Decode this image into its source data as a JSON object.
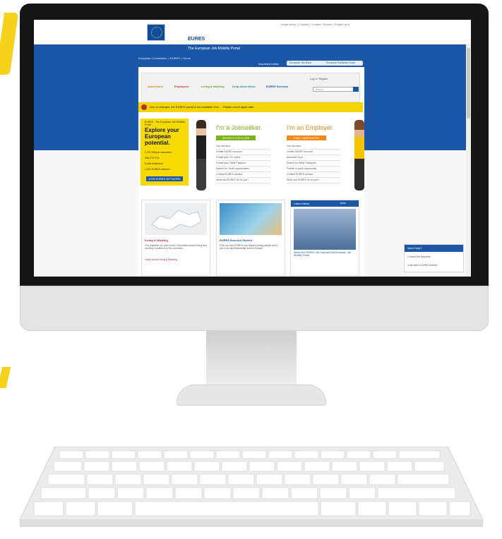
{
  "colors": {
    "eures_blue": "#1c56a6",
    "eu_yellow": "#f8d900",
    "jobseeker_green": "#7bb31a",
    "employer_orange": "#f08a1a",
    "monitor_bezel": "#161616",
    "monitor_body": "#e4e4e4"
  },
  "site": {
    "name": "EURES",
    "tagline": "The European Job Mobility Portal"
  },
  "top_links": "Legal notice | Cookies | Contact | Search | English (en)",
  "breadcrumb": "European Commission > EURES > Home",
  "language_label": "Important notice",
  "toolbar_items": [
    "European Job Days",
    "European Solidarity Corps"
  ],
  "nav": {
    "items": [
      "Jobseekers",
      "Employers",
      "Living & Working",
      "Drop-down Menu",
      "EURES Services"
    ]
  },
  "login_text": "Log in / Register",
  "search_placeholder": "Search",
  "alert": {
    "text": "Due to changes, the EURES portal is not available from ... Please check again later."
  },
  "explore": {
    "kicker": "EURES - The European Job Mobility Portal",
    "title": "Explore your European potential.",
    "stats": [
      "1,792,998 job vacancies",
      "266,275 CVs",
      "5,448 employers",
      "1,023 EURES advisers"
    ],
    "button": "JOIN EURES NETWORK"
  },
  "jobseeker": {
    "heading": "I'm a Jobseeker.",
    "button": "SEARCH FOR A JOB",
    "links": [
      "You can also:",
      "Create EURES account",
      "Create your CV online",
      "Create your Skills Passport",
      "Search for Youth opportunities",
      "Contact EURES advisor",
      "What can EURES do for you?"
    ]
  },
  "employer": {
    "heading": "I'm an Employer.",
    "button": "FIND CANDIDATES",
    "links": [
      "You can also:",
      "Create EURES account",
      "Advertise a job",
      "Search for Skills Passports",
      "Publish a youth opportunity",
      "Contact EURES advisor",
      "What can EURES do for you?"
    ]
  },
  "cards": [
    {
      "title": "Living & Working",
      "text": "Get prepared for your move! Information about living and working conditions in EU countries.",
      "link": "Learn about Living & Working"
    },
    {
      "title": "EURES Success Stories",
      "text": "Find out how EURES has helped young people find a job or an apprenticeship across Europe.",
      "link": ""
    },
    {
      "title": "Latest News",
      "text": "News from EURES Job Days and the European Job Mobility Portal",
      "link": "More"
    }
  ],
  "help": {
    "heading": "Need help?",
    "links": [
      "Contact the helpdesk",
      "Chat with a EURES adviser"
    ]
  }
}
